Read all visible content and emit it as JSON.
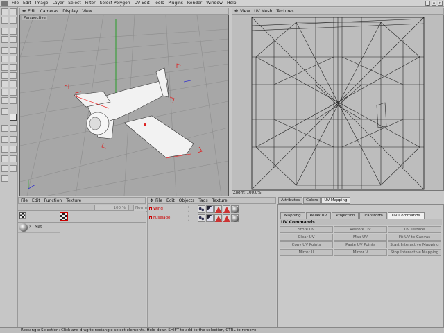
{
  "menubar": {
    "items": [
      "File",
      "Edit",
      "Image",
      "Layer",
      "Select",
      "Filter",
      "Select Polygon",
      "UV Edit",
      "Tools",
      "Plugins",
      "Render",
      "Window",
      "Help"
    ]
  },
  "viewport": {
    "menu": [
      "Edit",
      "Cameras",
      "Display",
      "View"
    ],
    "label": "Perspective"
  },
  "uv": {
    "menu": [
      "View",
      "UV Mesh",
      "Textures"
    ],
    "zoom": "Zoom: 100.0%"
  },
  "materials": {
    "menu": [
      "File",
      "Edit",
      "Function",
      "Texture"
    ],
    "zoom": "100 %",
    "mode": "Normal",
    "material_name": "Mat"
  },
  "objects": {
    "menu": [
      "File",
      "Edit",
      "Objects",
      "Tags",
      "Texture"
    ],
    "rows": [
      {
        "name": "Wing"
      },
      {
        "name": "Fuselage"
      }
    ]
  },
  "attributes": {
    "tabs": [
      "Attributes",
      "Colors",
      "UV Mapping"
    ],
    "active_tab": "UV Mapping",
    "subtabs": [
      "Mapping",
      "Relax UV",
      "Projection",
      "Transform",
      "UV Commands"
    ],
    "active_subtab": "UV Commands",
    "section": "UV Commands",
    "buttons": [
      "Store UV",
      "Restore UV",
      "UV Terrace",
      "Clear UV",
      "Max UV",
      "Fit UV to Canvas",
      "Copy UV Points",
      "Paste UV Points",
      "Start Interactive Mapping",
      "Mirror U",
      "Mirror V",
      "Stop Interactive Mapping"
    ]
  },
  "status": "Rectangle Selection: Click and drag to rectangle select elements. Hold down SHIFT to add to the selection, CTRL to remove."
}
